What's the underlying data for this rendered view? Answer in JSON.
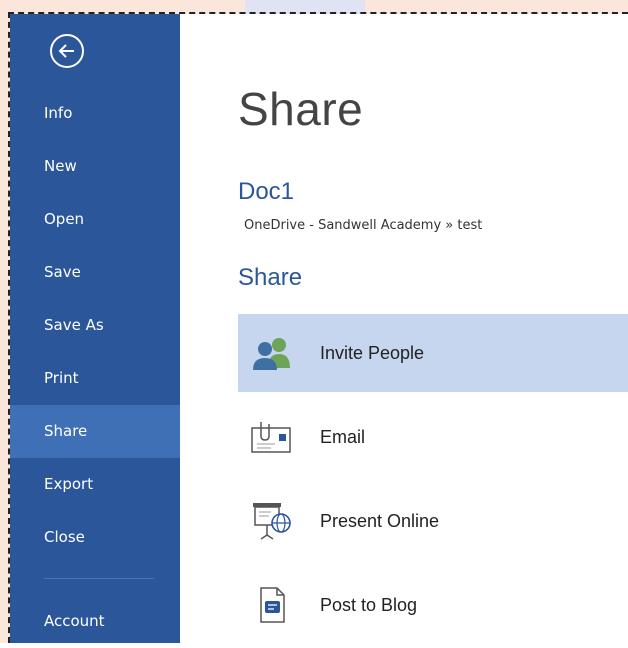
{
  "sidebar": {
    "items": [
      {
        "label": "Info"
      },
      {
        "label": "New"
      },
      {
        "label": "Open"
      },
      {
        "label": "Save"
      },
      {
        "label": "Save As"
      },
      {
        "label": "Print"
      },
      {
        "label": "Share"
      },
      {
        "label": "Export"
      },
      {
        "label": "Close"
      },
      {
        "label": "Account"
      }
    ],
    "active": "Share",
    "accent": "#2b579a",
    "active_bg": "#3f6fb5"
  },
  "main": {
    "title": "Share",
    "document": {
      "name": "Doc1",
      "path": "OneDrive - Sandwell Academy » test"
    },
    "section_heading": "Share",
    "options": [
      {
        "label": "Invite People",
        "icon": "people-icon"
      },
      {
        "label": "Email",
        "icon": "email-icon"
      },
      {
        "label": "Present Online",
        "icon": "present-online-icon"
      },
      {
        "label": "Post to Blog",
        "icon": "blog-icon"
      }
    ],
    "selected_bg": "#c5d6ee"
  }
}
